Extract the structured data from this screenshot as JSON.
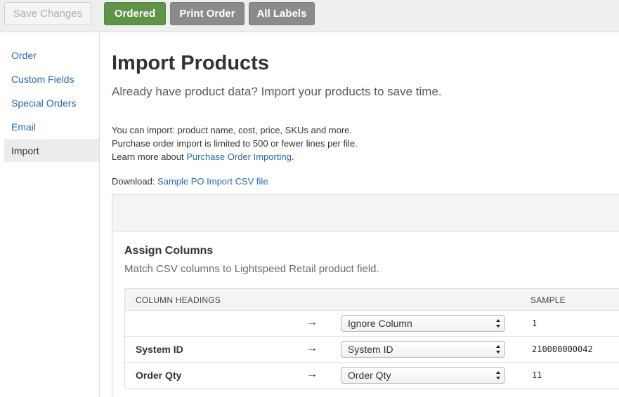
{
  "toolbar": {
    "save_label": "Save Changes",
    "ordered_label": "Ordered",
    "print_label": "Print Order",
    "labels_label": "All Labels"
  },
  "sidebar": {
    "items": [
      {
        "label": "Order"
      },
      {
        "label": "Custom Fields"
      },
      {
        "label": "Special Orders"
      },
      {
        "label": "Email"
      },
      {
        "label": "Import",
        "active": true
      }
    ]
  },
  "main": {
    "title": "Import Products",
    "subtitle": "Already have product data? Import your products to save time.",
    "info_line1": "You can import: product name, cost, price, SKUs and more.",
    "info_line2": "Purchase order import is limited to 500 or fewer lines per file.",
    "info_line3_prefix": "Learn more about ",
    "info_line3_link": "Purchase Order Importing",
    "info_line3_suffix": ".",
    "download_prefix": "Download: ",
    "download_link": "Sample PO Import CSV file"
  },
  "assign": {
    "title": "Assign Columns",
    "subtitle": "Match CSV columns to Lightspeed Retail product field.",
    "header_left": "COLUMN HEADINGS",
    "header_sample": "SAMPLE",
    "arrow": "→",
    "rows": [
      {
        "heading": "",
        "selected": "Ignore Column",
        "sample": "1"
      },
      {
        "heading": "System ID",
        "selected": "System ID",
        "sample": "210000000042"
      },
      {
        "heading": "Order Qty",
        "selected": "Order Qty",
        "sample": "11"
      }
    ]
  },
  "colors": {
    "accent_green": "#5f9349",
    "button_gray": "#8b8b8b",
    "link_blue": "#2c68a8"
  }
}
